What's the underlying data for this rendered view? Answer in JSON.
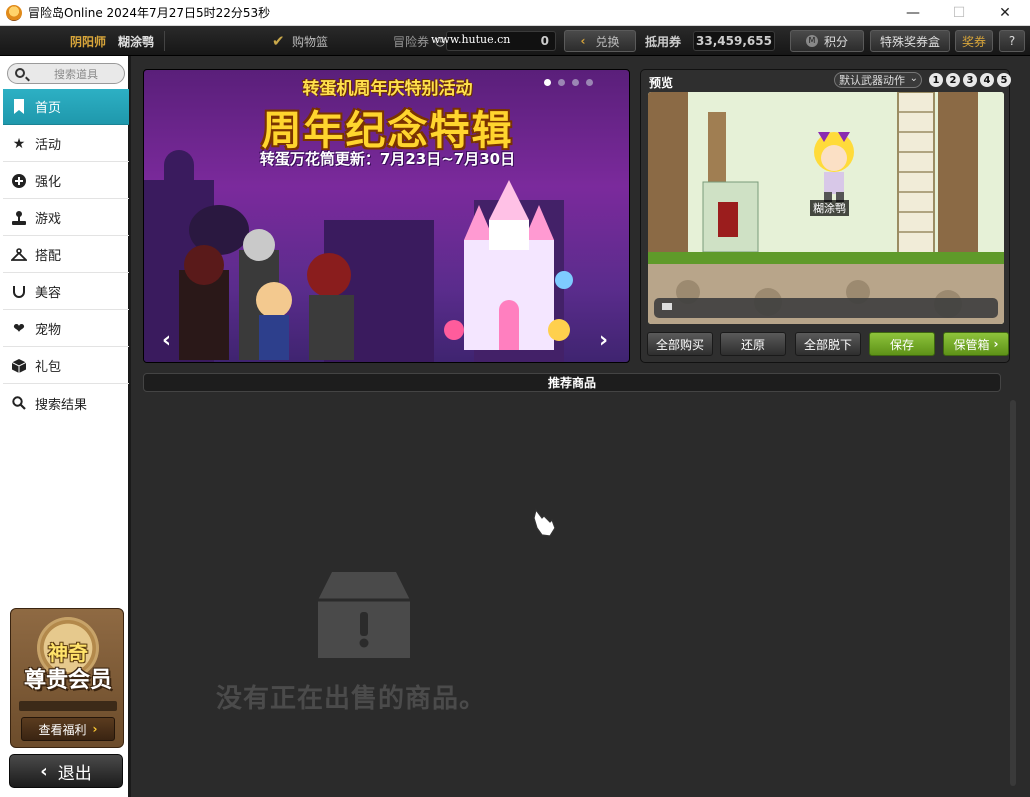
{
  "window": {
    "title": "冒险岛Online  2024年7月27日5时22分53秒",
    "minimize_glyph": "—",
    "maximize_glyph": "☐",
    "close_glyph": "✕"
  },
  "topbar": {
    "job": "阴阳师",
    "character": "糊涂鹗",
    "cart_label": "购物篮",
    "maple_points_label": "冒险券",
    "watermark": "www.hutue.cn",
    "maple_points_value": "0",
    "exchange_label": "兑换",
    "voucher_label": "抵用券",
    "voucher_value": "33,459,655",
    "points_label": "积分",
    "special_box_label": "特殊奖券盒",
    "reward_label": "奖券",
    "help_label": "?"
  },
  "sidebar": {
    "search_placeholder": "搜索道具",
    "items": [
      {
        "label": "首页",
        "icon": "bookmark-icon",
        "active": true
      },
      {
        "label": "活动",
        "icon": "star-icon",
        "active": false
      },
      {
        "label": "强化",
        "icon": "plus-circle-icon",
        "active": false
      },
      {
        "label": "游戏",
        "icon": "joystick-icon",
        "active": false
      },
      {
        "label": "搭配",
        "icon": "hanger-icon",
        "active": false
      },
      {
        "label": "美容",
        "icon": "face-icon",
        "active": false
      },
      {
        "label": "宠物",
        "icon": "heart-icon",
        "active": false
      },
      {
        "label": "礼包",
        "icon": "box-icon",
        "active": false
      },
      {
        "label": "搜索结果",
        "icon": "search-icon",
        "active": false
      }
    ],
    "vip": {
      "line1": "神奇",
      "line2": "尊贵会员",
      "button_label": "查看福利"
    },
    "logout_label": "退出"
  },
  "banner": {
    "pre_title": "转蛋机周年庆特别活动",
    "title": "周年纪念特辑",
    "subtitle": "转蛋万花筒更新：7月23日~7月30日",
    "slide_count": 4,
    "active_slide": 0
  },
  "preview": {
    "label": "预览",
    "action_select_value": "默认武器动作",
    "slots": [
      "1",
      "2",
      "3",
      "4",
      "5"
    ],
    "character_name": "糊涂鹗",
    "buttons": {
      "buy_all": "全部购买",
      "restore": "还原",
      "remove_all": "全部脱下",
      "save": "保存",
      "storage": "保管箱"
    }
  },
  "recommend": {
    "title": "推荐商品",
    "empty_message": "没有正在出售的商品。"
  },
  "colors": {
    "accent": "#1f98ac",
    "save_green": "#7ab22a",
    "gold": "#ffd52e"
  }
}
